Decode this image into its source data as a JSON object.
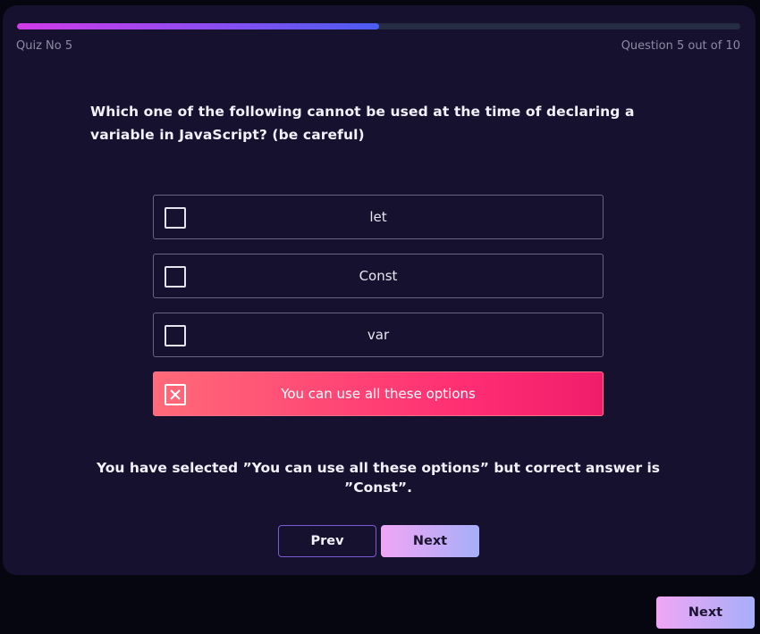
{
  "quiz": {
    "name": "Quiz No 5",
    "progress_text": "Question 5 out of 10",
    "progress_fraction": 0.5,
    "question": "Which one of the following cannot be used at the time of declaring a variable in JavaScript? (be careful)",
    "options": [
      {
        "label": "let",
        "state": "unchecked"
      },
      {
        "label": "Const",
        "state": "unchecked"
      },
      {
        "label": "var",
        "state": "unchecked"
      },
      {
        "label": "You can use all these options",
        "state": "selected-wrong"
      }
    ],
    "feedback": "You have selected ”You can use all these options” but correct answer is ”Const”."
  },
  "buttons": {
    "prev_label": "Prev",
    "next_label": "Next",
    "outer_next_label": "Next"
  },
  "colors": {
    "card_bg": "#171130",
    "page_bg": "#05060f",
    "wrong_option": "#ff2d73",
    "progress_start": "#d13be8",
    "progress_end": "#4a5cf0"
  }
}
